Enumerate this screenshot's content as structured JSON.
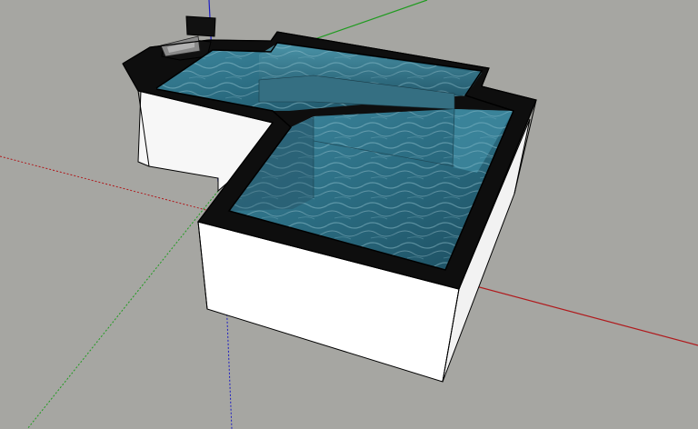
{
  "viewport": {
    "background_color": "#a6a6a2",
    "axes": {
      "red_axis_color": "#b0191c",
      "green_axis_color": "#1f9b1f",
      "blue_axis_color": "#1d1dc4"
    },
    "model": {
      "coping_color": "#0e0e0e",
      "wall_color": "#ffffff",
      "wall_shade_color": "#f2f2f2",
      "edge_color": "#000000",
      "water_colors": [
        "#1c4a5c",
        "#2f6e84",
        "#4b93a8",
        "#8cc3d0"
      ],
      "equipment_color": "#8a8a8a"
    }
  }
}
